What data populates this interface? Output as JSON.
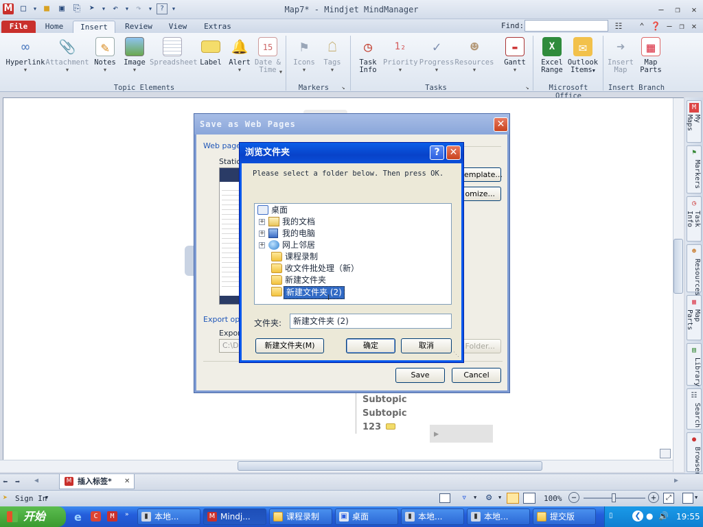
{
  "app": {
    "title": "Map7* - Mindjet MindManager"
  },
  "tabs": {
    "file": "File",
    "home": "Home",
    "insert": "Insert",
    "review": "Review",
    "view": "View",
    "extras": "Extras",
    "find_label": "Find:"
  },
  "ribbon": {
    "hyperlink": "Hyperlink",
    "attachment": "Attachment",
    "notes": "Notes",
    "image": "Image",
    "spreadsheet": "Spreadsheet",
    "label": "Label",
    "alert": "Alert",
    "date_time_1": "Date &",
    "date_time_2": "Time",
    "icons": "Icons",
    "tags": "Tags",
    "task_info_1": "Task",
    "task_info_2": "Info",
    "priority": "Priority",
    "progress": "Progress",
    "resources": "Resources",
    "gantt": "Gantt",
    "excel_1": "Excel",
    "excel_2": "Range",
    "outlook_1": "Outlook",
    "outlook_2": "Items",
    "insert_map_1": "Insert",
    "insert_map_2": "Map",
    "map_parts_1": "Map",
    "map_parts_2": "Parts",
    "group_topic_elements": "Topic Elements",
    "group_markers": "Markers",
    "group_tasks": "Tasks",
    "group_office": "Microsoft Office",
    "group_insert_branch": "Insert Branch"
  },
  "side_tabs": [
    "My Maps",
    "Markers",
    "Task Info",
    "Resources",
    "Map Parts",
    "Library",
    "Search",
    "Browser"
  ],
  "map": {
    "subtopic_1": "Subtopic",
    "subtopic_2": "Subtopic",
    "topic_123": "123"
  },
  "save_dialog": {
    "title": "Save as Web Pages",
    "web_page_label": "Web page l",
    "static_label": "Static c",
    "template_button": "emplate...",
    "customize_button": "omize...",
    "export_options": "Export opti",
    "export_label": "Export",
    "path_value": "C:\\D",
    "folder_button": "Folder...",
    "save_button": "Save",
    "cancel_button": "Cancel"
  },
  "browse_dialog": {
    "title": "浏览文件夹",
    "instruction": "Please select a folder below. Then press OK.",
    "tree": [
      {
        "label": "桌面",
        "indent": 0,
        "expander": false,
        "icon": "desktop-icon"
      },
      {
        "label": "我的文档",
        "indent": 1,
        "expander": true,
        "icon": "documents-icon"
      },
      {
        "label": "我的电脑",
        "indent": 1,
        "expander": true,
        "icon": "computer-icon"
      },
      {
        "label": "网上邻居",
        "indent": 1,
        "expander": true,
        "icon": "network-icon"
      },
      {
        "label": "课程录制",
        "indent": 1,
        "expander": false,
        "icon": "folder-icon"
      },
      {
        "label": "收文件批处理（新）",
        "indent": 1,
        "expander": false,
        "icon": "folder-icon"
      },
      {
        "label": "新建文件夹",
        "indent": 1,
        "expander": false,
        "icon": "folder-icon"
      },
      {
        "label": "新建文件夹 (2)",
        "indent": 1,
        "expander": false,
        "icon": "folder-icon",
        "selected": true
      }
    ],
    "folder_label": "文件夹:",
    "folder_value": "新建文件夹 (2)",
    "new_folder_button": "新建文件夹(M)",
    "ok_button": "确定",
    "cancel_button": "取消"
  },
  "doc_tab": {
    "label": "插入标签*"
  },
  "status": {
    "sign_in": "Sign In",
    "zoom": "100%"
  },
  "taskbar": {
    "start": "开始",
    "buttons": [
      "本地...",
      "Mindj...",
      "课程录制",
      "桌面",
      "本地...",
      "本地...",
      "提交版"
    ],
    "clock": "19:55"
  }
}
